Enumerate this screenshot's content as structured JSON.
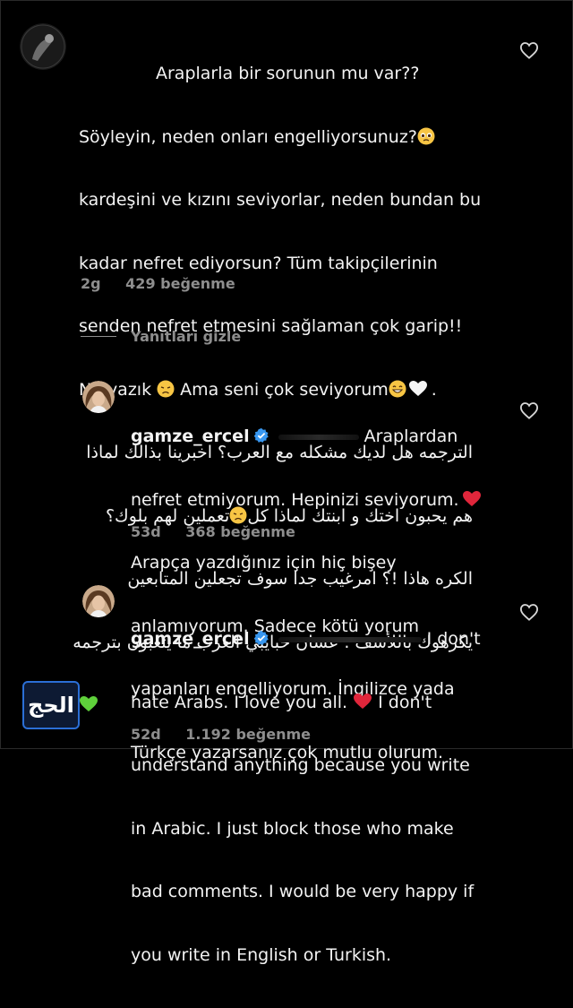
{
  "comment1": {
    "lines": [
      "Araplarla bir sorunun mu var??",
      "Söyleyin, neden onları engelliyorsunuz?",
      "kardeşini ve kızını seviyorlar, neden bundan bu",
      "kadar nefret  ediyorsun? Tüm takipçilerinin",
      "senden nefret etmesini sağlaman çok garip!!",
      "Ne yazık ",
      " Ama seni çok seviyorum",
      ".",
      "الترجمه  هل لديك مشكله مع العرب؟ اخبرينا بذالك لماذا",
      "تعملين لهم بلوك؟",
      " هم يحبون اختك و ابنتك لماذا كل",
      "الكره هاذا !؟ امرغيب جدا سوف تجعلين المتابعين",
      "يكرهوك باللأسف . عشان حبايبي العرب ما يتعبون بترجمه"
    ],
    "time": "2g",
    "likes": "429 beğenme"
  },
  "hide_replies": "Yanıtları gizle",
  "reply1": {
    "username": "gamze_ercel",
    "lines": [
      "Araplardan",
      "nefret etmiyorum. Hepinizi seviyorum.",
      "Arapça yazdığınız için hiç bişey",
      "anlamıyorum. Sadece kötü yorum",
      "yapanları engelliyorum. İngilizce yada",
      "Türkçe yazarsanız çok mutlu olurum."
    ],
    "time": "53d",
    "likes": "368 beğenme"
  },
  "reply2": {
    "username": "gamze_ercel",
    "lines": [
      "I don't",
      "hate Arabs.  I love you all. ",
      " I don't",
      "understand anything because you write",
      "in Arabic.  I just block those who make",
      "bad comments.  I would be very happy if",
      "you write in English or Turkish."
    ],
    "time": "52d",
    "likes": "1.192 beğenme"
  },
  "icons": {
    "like": "heart-outline-icon",
    "verified": "verified-badge-icon",
    "watermark": "site-logo"
  },
  "watermark_text": "الحج",
  "colors": {
    "background": "#000000",
    "text": "#f3f3f3",
    "muted": "#8e8e8e",
    "verified": "#3897f0",
    "red_heart": "#e0263b",
    "green_heart": "#5fd13b"
  }
}
